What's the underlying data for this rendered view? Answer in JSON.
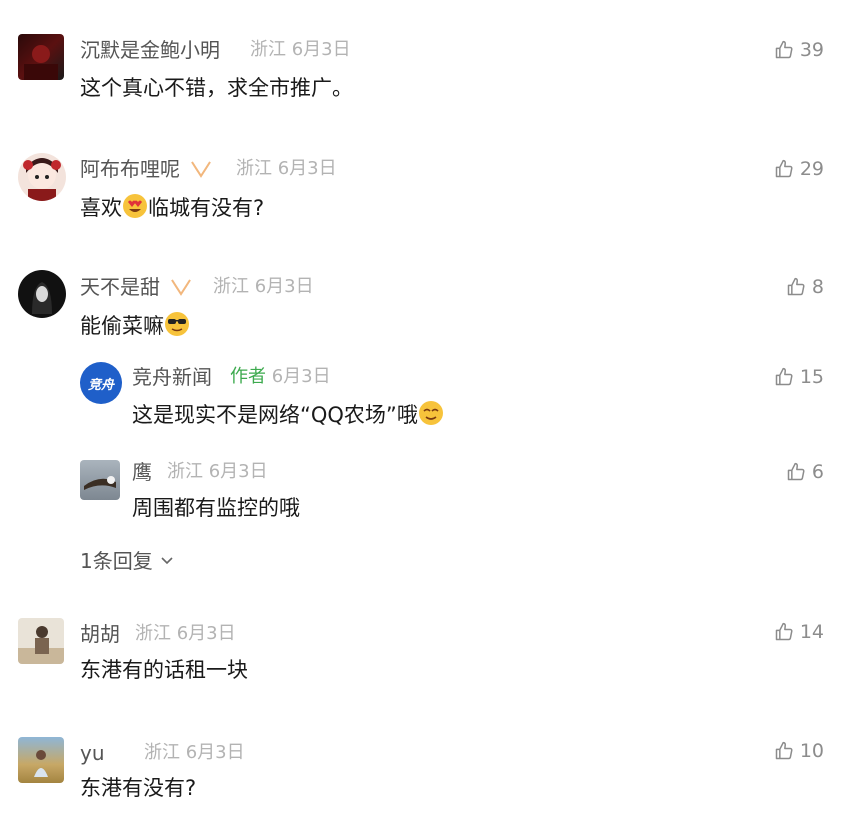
{
  "comments": [
    {
      "name": "沉默是金鲍小明",
      "location": "浙江",
      "date": "6月3日",
      "text": "这个真心不错，求全市推广。",
      "likes": "39"
    },
    {
      "name": "阿布布哩呢",
      "location": "浙江",
      "date": "6月3日",
      "text_before": "喜欢",
      "text_after": "临城有没有?",
      "likes": "29"
    },
    {
      "name": "天不是甜",
      "location": "浙江",
      "date": "6月3日",
      "text": "能偷菜嘛",
      "likes": "8",
      "replies": [
        {
          "name": "竞舟新闻",
          "tag": "作者",
          "date": "6月3日",
          "text": "这是现实不是网络“QQ农场”哦",
          "likes": "15",
          "avatar_text": "竞舟"
        },
        {
          "name": "鹰",
          "location": "浙江",
          "date": "6月3日",
          "text": "周围都有监控的哦",
          "likes": "6"
        }
      ],
      "more_replies": "1条回复"
    },
    {
      "name": "胡胡",
      "location": "浙江",
      "date": "6月3日",
      "text": "东港有的话租一块",
      "likes": "14"
    },
    {
      "name": "yu",
      "location": "浙江",
      "date": "6月3日",
      "text": "东港有没有?",
      "likes": "10"
    }
  ],
  "icons": {
    "like": "thumbs-up-icon",
    "vip": "vip-badge-icon",
    "expand": "chevron-down-icon"
  },
  "colors": {
    "author_tag": "#3daa4e",
    "meta": "#b3b3b3",
    "name": "#555555"
  }
}
